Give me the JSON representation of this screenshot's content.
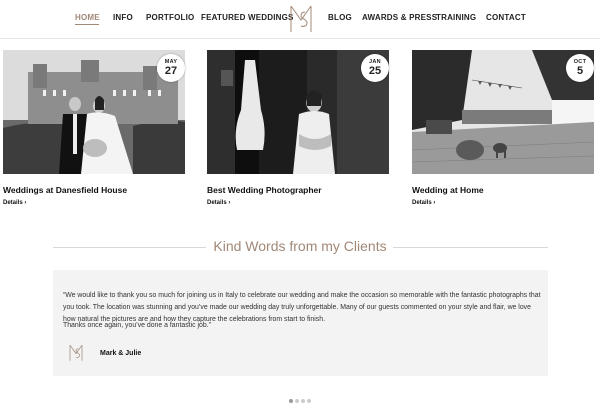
{
  "nav": {
    "items": [
      {
        "label": "HOME",
        "active": true
      },
      {
        "label": "INFO"
      },
      {
        "label": "PORTFOLIO"
      },
      {
        "label": "FEATURED WEDDINGS"
      },
      {
        "label": "BLOG"
      },
      {
        "label": "AWARDS & PRESS"
      },
      {
        "label": "TRAINING"
      },
      {
        "label": "CONTACT"
      }
    ],
    "logo_icon": "ms-monogram-icon",
    "accent_color": "#a08877"
  },
  "posts": [
    {
      "month": "MAY",
      "day": "27",
      "title": "Weddings at Danesfield House",
      "details": "Details ›",
      "photo": "bride-groom-castle-photo"
    },
    {
      "month": "JAN",
      "day": "25",
      "title": "Best Wedding Photographer",
      "details": "Details ›",
      "photo": "bride-window-photo"
    },
    {
      "month": "OCT",
      "day": "5",
      "title": "Wedding at Home",
      "details": "Details ›",
      "photo": "garden-dog-photo"
    }
  ],
  "testimonials": {
    "heading": "Kind Words from my Clients",
    "quote_1": "“We would like to thank you so much for joining us in Italy to celebrate our wedding and make the occasion so memorable with the fantastic photographs that you took. The location was stunning and you’ve made our wedding day truly unforgettable. Many of our guests commented on your style and flair, we love how natural the pictures are and how they capture the celebrations from start to finish.",
    "quote_2": "Thanks once again, you’ve done a fantastic job.”",
    "author": "Mark & Julie",
    "slider_dots": 4,
    "active_dot": 0
  }
}
